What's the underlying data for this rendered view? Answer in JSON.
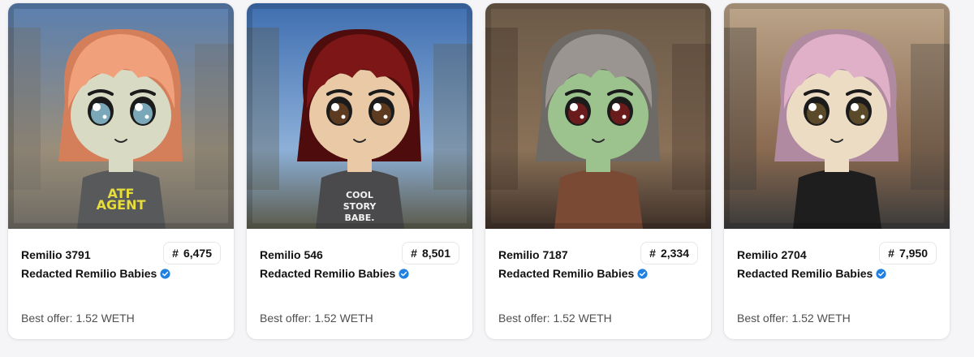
{
  "cards": [
    {
      "name": "Remilio 3791",
      "rank": "6,475",
      "collection": "Redacted Remilio Babies",
      "offer": "Best offer: 1.52 WETH",
      "art": {
        "sky": "#5a7fb0",
        "bg": "#9a8e7a",
        "ground": "#6d6a63",
        "hair": "#f0a07a",
        "hair_dark": "#d57f5a",
        "skin": "#d9dac4",
        "eye": "#7aa8b8",
        "shirt": "#58595b",
        "shirt_text": "ATF\nAGENT",
        "shirt_text_color": "#e6dc3c"
      }
    },
    {
      "name": "Remilio 546",
      "rank": "8,501",
      "collection": "Redacted Remilio Babies",
      "offer": "Best offer: 1.52 WETH",
      "art": {
        "sky": "#3f6eb0",
        "bg": "#8db0d8",
        "ground": "#5a5a4a",
        "hair": "#7d1616",
        "hair_dark": "#4e0c0c",
        "skin": "#e9c9a6",
        "eye": "#5c3b20",
        "shirt": "#4a4a4c",
        "shirt_text": "COOL\nSTORY\nBABE.",
        "shirt_text_color": "#f2f2f2"
      }
    },
    {
      "name": "Remilio 7187",
      "rank": "2,334",
      "collection": "Redacted Remilio Babies",
      "offer": "Best offer: 1.52 WETH",
      "art": {
        "sky": "#6b5a48",
        "bg": "#8a7158",
        "ground": "#3e3028",
        "hair": "#9a9590",
        "hair_dark": "#6e6a66",
        "skin": "#9cc28e",
        "eye": "#6a1c1c",
        "shirt": "#7a4a34",
        "shirt_text": "",
        "shirt_text_color": "#e8d4b8"
      }
    },
    {
      "name": "Remilio 2704",
      "rank": "7,950",
      "collection": "Redacted Remilio Babies",
      "offer": "Best offer: 1.52 WETH",
      "art": {
        "sky": "#bca58a",
        "bg": "#8a6a50",
        "ground": "#3a3a3a",
        "hair": "#e0b0c8",
        "hair_dark": "#b08aa0",
        "skin": "#ecdcc4",
        "eye": "#5a4a2a",
        "shirt": "#1e1e1e",
        "shirt_text": "",
        "shirt_text_color": "#d63030"
      }
    }
  ],
  "icons": {
    "verified": "verified-check-icon",
    "rank": "hash-icon"
  },
  "rank_symbol": "#",
  "accent": "#2081e2"
}
